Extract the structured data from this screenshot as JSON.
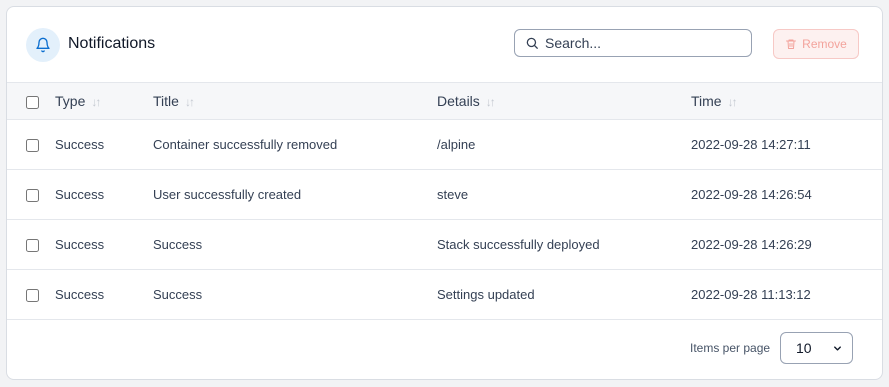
{
  "header": {
    "title": "Notifications",
    "search_placeholder": "Search...",
    "remove_label": "Remove"
  },
  "table": {
    "columns": {
      "type": "Type",
      "title": "Title",
      "details": "Details",
      "time": "Time"
    },
    "rows": [
      {
        "type": "Success",
        "title": "Container successfully removed",
        "details": "/alpine",
        "time": "2022-09-28 14:27:11"
      },
      {
        "type": "Success",
        "title": "User successfully created",
        "details": "steve",
        "time": "2022-09-28 14:26:54"
      },
      {
        "type": "Success",
        "title": "Success",
        "details": "Stack successfully deployed",
        "time": "2022-09-28 14:26:29"
      },
      {
        "type": "Success",
        "title": "Success",
        "details": "Settings updated",
        "time": "2022-09-28 11:13:12"
      }
    ]
  },
  "footer": {
    "items_per_page_label": "Items per page",
    "items_per_page_value": "10"
  },
  "icons": {
    "header": "bell-icon",
    "search": "search-icon",
    "remove": "trash-icon",
    "sort": "sort-arrows-icon",
    "select": "chevron-down-icon"
  },
  "colors": {
    "accent": "#0b6ecf",
    "danger_disabled": "#f3a39c"
  }
}
